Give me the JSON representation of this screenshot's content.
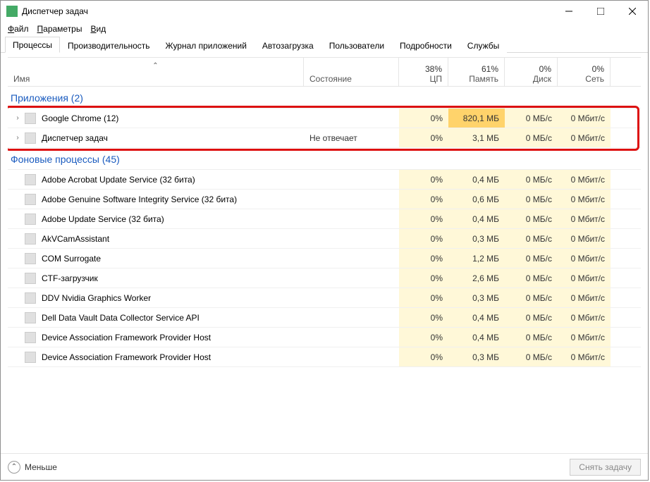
{
  "title": "Диспетчер задач",
  "menus": [
    "Файл",
    "Параметры",
    "Вид"
  ],
  "tabs": [
    "Процессы",
    "Производительность",
    "Журнал приложений",
    "Автозагрузка",
    "Пользователи",
    "Подробности",
    "Службы"
  ],
  "active_tab": 0,
  "columns": {
    "name": "Имя",
    "state": "Состояние",
    "cpu": {
      "pct": "38%",
      "label": "ЦП"
    },
    "mem": {
      "pct": "61%",
      "label": "Память"
    },
    "disk": {
      "pct": "0%",
      "label": "Диск"
    },
    "net": {
      "pct": "0%",
      "label": "Сеть"
    }
  },
  "groups": [
    {
      "title": "Приложения (2)",
      "rows": [
        {
          "expand": true,
          "name": "Google Chrome (12)",
          "state": "",
          "cpu": "0%",
          "mem": "820,1 МБ",
          "mem_hi": true,
          "disk": "0 МБ/с",
          "net": "0 Мбит/с"
        },
        {
          "expand": true,
          "name": "Диспетчер задач",
          "state": "Не отвечает",
          "cpu": "0%",
          "mem": "3,1 МБ",
          "disk": "0 МБ/с",
          "net": "0 Мбит/с"
        }
      ]
    },
    {
      "title": "Фоновые процессы (45)",
      "rows": [
        {
          "name": "Adobe Acrobat Update Service (32 бита)",
          "cpu": "0%",
          "mem": "0,4 МБ",
          "disk": "0 МБ/с",
          "net": "0 Мбит/с"
        },
        {
          "name": "Adobe Genuine Software Integrity Service (32 бита)",
          "cpu": "0%",
          "mem": "0,6 МБ",
          "disk": "0 МБ/с",
          "net": "0 Мбит/с"
        },
        {
          "name": "Adobe Update Service (32 бита)",
          "cpu": "0%",
          "mem": "0,4 МБ",
          "disk": "0 МБ/с",
          "net": "0 Мбит/с"
        },
        {
          "name": "AkVCamAssistant",
          "cpu": "0%",
          "mem": "0,3 МБ",
          "disk": "0 МБ/с",
          "net": "0 Мбит/с"
        },
        {
          "name": "COM Surrogate",
          "cpu": "0%",
          "mem": "1,2 МБ",
          "disk": "0 МБ/с",
          "net": "0 Мбит/с"
        },
        {
          "name": "CTF-загрузчик",
          "cpu": "0%",
          "mem": "2,6 МБ",
          "disk": "0 МБ/с",
          "net": "0 Мбит/с"
        },
        {
          "name": "DDV Nvidia Graphics Worker",
          "cpu": "0%",
          "mem": "0,3 МБ",
          "disk": "0 МБ/с",
          "net": "0 Мбит/с"
        },
        {
          "name": "Dell Data Vault Data Collector Service API",
          "cpu": "0%",
          "mem": "0,4 МБ",
          "disk": "0 МБ/с",
          "net": "0 Мбит/с"
        },
        {
          "name": "Device Association Framework Provider Host",
          "cpu": "0%",
          "mem": "0,4 МБ",
          "disk": "0 МБ/с",
          "net": "0 Мбит/с"
        },
        {
          "name": "Device Association Framework Provider Host",
          "cpu": "0%",
          "mem": "0,3 МБ",
          "disk": "0 МБ/с",
          "net": "0 Мбит/с"
        }
      ]
    }
  ],
  "footer": {
    "less": "Меньше",
    "end_task": "Снять задачу"
  }
}
